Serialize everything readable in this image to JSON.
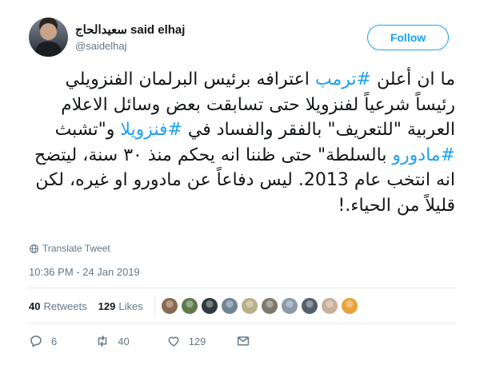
{
  "author": {
    "display_name": "سعيدالحاج said elhaj",
    "handle": "@saidelhaj",
    "follow_label": "Follow"
  },
  "tweet": {
    "segments": [
      {
        "text": "ما ان أعلن ",
        "hashtag": false
      },
      {
        "text": "#ترمب",
        "hashtag": true
      },
      {
        "text": " اعترافه برئيس البرلمان الفنزويلي رئيساً شرعياً لفنزويلا حتى تسابقت بعض وسائل الاعلام العربية \"للتعريف\" بالفقر والفساد في ",
        "hashtag": false
      },
      {
        "text": "#فنزويلا",
        "hashtag": true
      },
      {
        "text": " و\"تشبث ",
        "hashtag": false
      },
      {
        "text": "#مادورو",
        "hashtag": true
      },
      {
        "text": " بالسلطة\" حتى ظننا انه يحكم منذ ٣٠ سنة، ليتضح انه انتخب عام 2013. ليس دفاعاً عن مادورو او غيره، لكن قليلاً من الحياء.!",
        "hashtag": false
      }
    ]
  },
  "translate_label": "Translate Tweet",
  "timestamp": "10:36 PM - 24 Jan 2019",
  "stats": {
    "retweets_count": "40",
    "retweets_label": "Retweets",
    "likes_count": "129",
    "likes_label": "Likes"
  },
  "liker_avatars": [
    "#8a6a4f",
    "#5e7a4a",
    "#2f3a40",
    "#6f8596",
    "#b8b08a",
    "#7d7a6c",
    "#8b9aa8",
    "#54606b",
    "#c8b09a",
    "#e8a23a"
  ],
  "actions": {
    "reply_count": "6",
    "retweet_count": "40",
    "like_count": "129"
  },
  "colors": {
    "accent": "#1da1f2",
    "muted": "#657786"
  }
}
